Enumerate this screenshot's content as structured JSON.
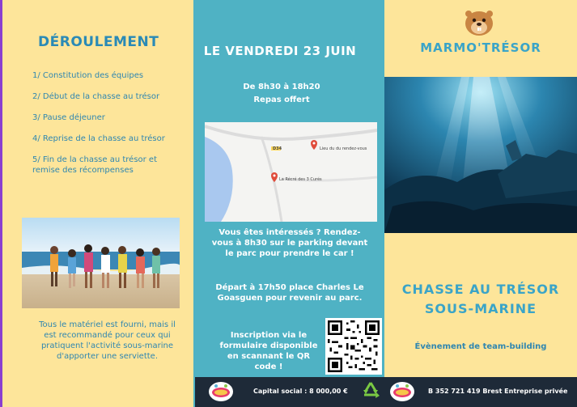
{
  "left": {
    "title": "DÉROULEMENT",
    "steps": [
      "1/ Constitution des équipes",
      "2/ Début de la chasse au trésor",
      "3/ Pause déjeuner",
      "4/ Reprise de la chasse au trésor",
      "5/ Fin de la chasse au trésor et remise des récompenses"
    ],
    "note": "Tous le matériel est fourni, mais il est recommandé pour ceux qui pratiquent l'activité sous-marine d'apporter une serviette."
  },
  "middle": {
    "date": "LE VENDREDI 23 JUIN",
    "hours": "De 8h30 à 18h20",
    "meal": "Repas offert",
    "map": {
      "place1": "Lieu du du rendez-vous",
      "place2": "La Récré des 3 Curés",
      "road": "D34"
    },
    "text1": "Vous êtes intéressés ? Rendez-vous à 8h30 sur le parking devant le parc pour prendre le car !",
    "text2": "Départ à 17h50 place Charles Le Goasguen pour revenir au parc.",
    "signup": "Inscription via le formulaire disponible en scannant le QR code !"
  },
  "right": {
    "brand": "MARMO'TRÉSOR",
    "hunt_title_line1": "CHASSE AU TRÉSOR",
    "hunt_title_line2": "SOUS-MARINE",
    "subtitle": "Évènement de team-building"
  },
  "footer": {
    "capital": "Capital social : 8 000,00 €",
    "siret": "B 352 721 419 Brest Entreprise privée",
    "logo_text": "La Récré"
  },
  "colors": {
    "accent_blue": "#3aa4c8",
    "yellow_bg": "#fde59a",
    "teal_bg": "#4fb2c4",
    "footer_bg": "#1e2a38"
  }
}
